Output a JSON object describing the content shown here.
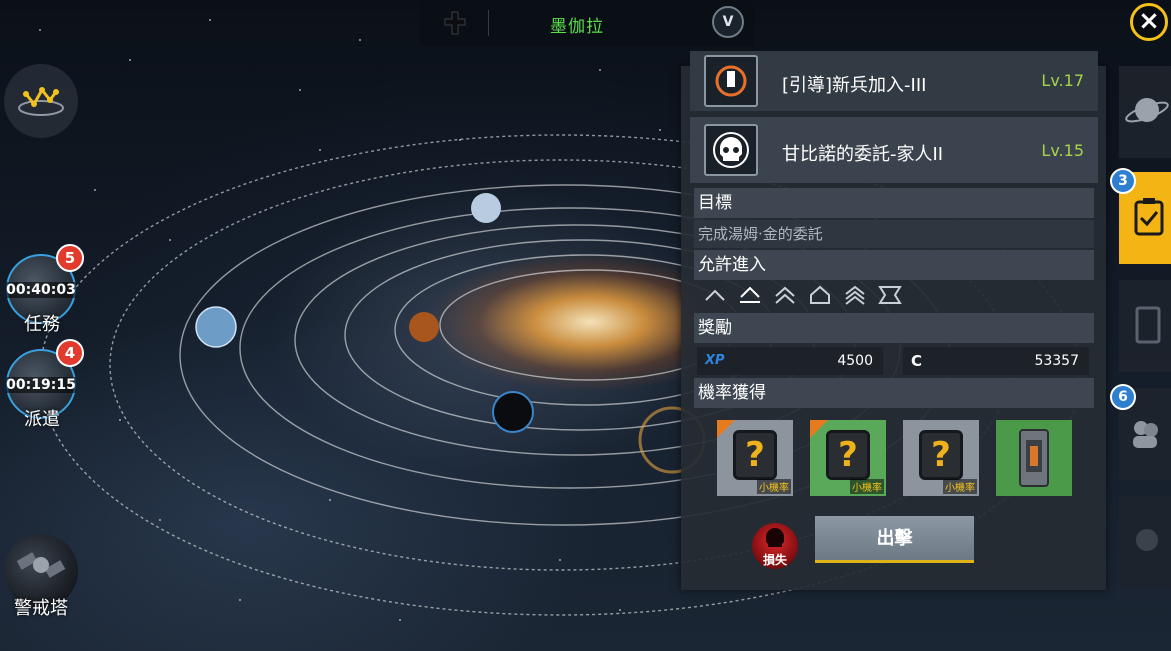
{
  "top_bar": {
    "location_name": "墨伽拉",
    "rank_badge": "V",
    "left_icon": "cross-icon"
  },
  "close_icon": "close-icon",
  "left_menu": {
    "star_map_icon": "constellation-icon",
    "missions": {
      "label": "任務",
      "timer": "00:40:03",
      "badge": "5"
    },
    "dispatch": {
      "label": "派遣",
      "timer": "00:19:15",
      "badge": "4"
    },
    "watchtower": {
      "label": "警戒塔"
    }
  },
  "mission_panel": {
    "missions": [
      {
        "title": "[引導]新兵加入-III",
        "level": "Lv.17",
        "icon": "emblem-icon"
      },
      {
        "title": "甘比諾的委託-家人II",
        "level": "Lv.15",
        "icon": "skull-icon"
      }
    ],
    "objective_header": "目標",
    "objective_text": "完成湯姆·金的委託",
    "access_header": "允許進入",
    "access_icons": [
      "chevron-icon",
      "frigate-icon",
      "double-chevron-icon",
      "pentagon-icon",
      "triple-chevron-icon",
      "bracket-icon"
    ],
    "rewards_header": "獎勵",
    "rewards": [
      {
        "key": "XP",
        "value": "4500"
      },
      {
        "key": "C",
        "value": "53357"
      }
    ],
    "drops_header": "機率獲得",
    "drops": [
      {
        "tag": "小機率",
        "color": "#8c959e"
      },
      {
        "tag": "小機率",
        "color": "#5aa85a"
      },
      {
        "tag": "小機率",
        "color": "#8c959e"
      },
      {
        "tag": "",
        "color": "#4a9a4a"
      }
    ],
    "loss_label": "損失",
    "sortie_label": "出擊"
  },
  "right_tabs": {
    "active_badge": "3",
    "fleet_badge": "6",
    "active_color": "#f4b514"
  }
}
